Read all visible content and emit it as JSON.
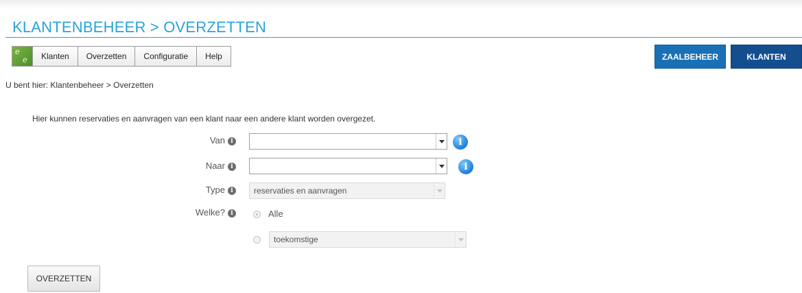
{
  "header": {
    "title": "KLANTENBEHEER > OVERZETTEN"
  },
  "menu": {
    "logo_letters": [
      "e",
      "e"
    ],
    "items": [
      "Klanten",
      "Overzetten",
      "Configuratie",
      "Help"
    ]
  },
  "top_buttons": {
    "zaalbeheer": "ZAALBEHEER",
    "klanten": "KLANTEN"
  },
  "breadcrumb": "U bent hier: Klantenbeheer > Overzetten",
  "intro": "Hier kunnen reservaties en aanvragen van een klant naar een andere klant worden overgezet.",
  "form": {
    "van": {
      "label": "Van",
      "value": ""
    },
    "naar": {
      "label": "Naar",
      "value": ""
    },
    "type": {
      "label": "Type",
      "value": "reservaties en aanvragen"
    },
    "welke": {
      "label": "Welke?",
      "options": [
        "Alle",
        "toekomstige"
      ],
      "selected": "Alle"
    }
  },
  "submit_label": "OVERZETTEN",
  "icons": {
    "info_small": "i",
    "info_big": "i"
  },
  "colors": {
    "title": "#29a3d8",
    "zaalbeheer": "#1a70b5",
    "klanten": "#134e8f"
  }
}
